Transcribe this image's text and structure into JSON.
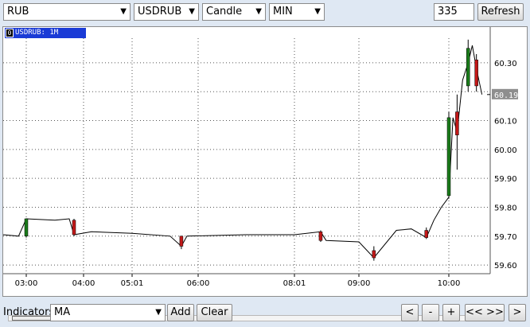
{
  "toolbar": {
    "currency": "RUB",
    "instrument": "USDRUB",
    "chart_type": "Candle",
    "interval": "MIN",
    "bar_count": "335",
    "refresh_label": "Refresh"
  },
  "chart": {
    "title": "USDRUB: 1M",
    "title_icon": "0",
    "current_price": "60.19",
    "colors": {
      "up": "#1a7a1a",
      "down": "#c21818",
      "line": "#000000",
      "title_bg": "#1a3bd6",
      "price_tag": "#8e8e8e"
    }
  },
  "chart_data": {
    "type": "candlestick",
    "ylim": [
      59.57,
      60.385
    ],
    "y_ticks": [
      "60.30",
      "60.20",
      "60.10",
      "60.00",
      "59.90",
      "59.80",
      "59.70",
      "59.60"
    ],
    "x_ticks": [
      "03:00",
      "04:00",
      "05:01",
      "06:00",
      "08:01",
      "09:00",
      "10:00"
    ],
    "grid": true,
    "price_path": [
      {
        "t": "02:45",
        "p": 59.705
      },
      {
        "t": "02:55",
        "p": 59.7
      },
      {
        "t": "03:00",
        "p": 59.76
      },
      {
        "t": "03:30",
        "p": 59.755
      },
      {
        "t": "03:45",
        "p": 59.76
      },
      {
        "t": "03:50",
        "p": 59.705
      },
      {
        "t": "04:10",
        "p": 59.715
      },
      {
        "t": "05:01",
        "p": 59.71
      },
      {
        "t": "05:35",
        "p": 59.7
      },
      {
        "t": "05:45",
        "p": 59.665
      },
      {
        "t": "05:50",
        "p": 59.7
      },
      {
        "t": "07:00",
        "p": 59.705
      },
      {
        "t": "08:01",
        "p": 59.705
      },
      {
        "t": "08:25",
        "p": 59.715
      },
      {
        "t": "08:30",
        "p": 59.685
      },
      {
        "t": "09:00",
        "p": 59.68
      },
      {
        "t": "09:10",
        "p": 59.625
      },
      {
        "t": "09:25",
        "p": 59.72
      },
      {
        "t": "09:35",
        "p": 59.725
      },
      {
        "t": "09:45",
        "p": 59.695
      },
      {
        "t": "09:50",
        "p": 59.755
      },
      {
        "t": "09:55",
        "p": 59.8
      },
      {
        "t": "10:00",
        "p": 59.835
      },
      {
        "t": "10:03",
        "p": 60.11
      },
      {
        "t": "10:06",
        "p": 60.06
      },
      {
        "t": "10:10",
        "p": 60.24
      },
      {
        "t": "10:14",
        "p": 60.3
      },
      {
        "t": "10:17",
        "p": 60.36
      },
      {
        "t": "10:20",
        "p": 60.28
      },
      {
        "t": "10:24",
        "p": 60.19
      }
    ],
    "key_candles": [
      {
        "t": "03:00",
        "open": 59.7,
        "high": 59.76,
        "low": 59.695,
        "close": 59.76
      },
      {
        "t": "03:50",
        "open": 59.755,
        "high": 59.76,
        "low": 59.7,
        "close": 59.705
      },
      {
        "t": "05:45",
        "open": 59.7,
        "high": 59.7,
        "low": 59.655,
        "close": 59.665
      },
      {
        "t": "08:25",
        "open": 59.715,
        "high": 59.72,
        "low": 59.68,
        "close": 59.685
      },
      {
        "t": "09:10",
        "open": 59.65,
        "high": 59.665,
        "low": 59.615,
        "close": 59.625
      },
      {
        "t": "09:45",
        "open": 59.72,
        "high": 59.73,
        "low": 59.69,
        "close": 59.695
      },
      {
        "t": "10:00",
        "open": 59.84,
        "high": 60.13,
        "low": 59.83,
        "close": 60.11
      },
      {
        "t": "10:06",
        "open": 60.13,
        "high": 60.19,
        "low": 59.93,
        "close": 60.05
      },
      {
        "t": "10:14",
        "open": 60.22,
        "high": 60.38,
        "low": 60.2,
        "close": 60.35
      },
      {
        "t": "10:20",
        "open": 60.31,
        "high": 60.33,
        "low": 60.2,
        "close": 60.22
      }
    ]
  },
  "bottom": {
    "indicators_label": "Indicators",
    "indicator": "MA",
    "add_label": "Add",
    "clear_label": "Clear",
    "nav": [
      "<",
      "-",
      "+",
      "<< >>",
      ">"
    ]
  }
}
